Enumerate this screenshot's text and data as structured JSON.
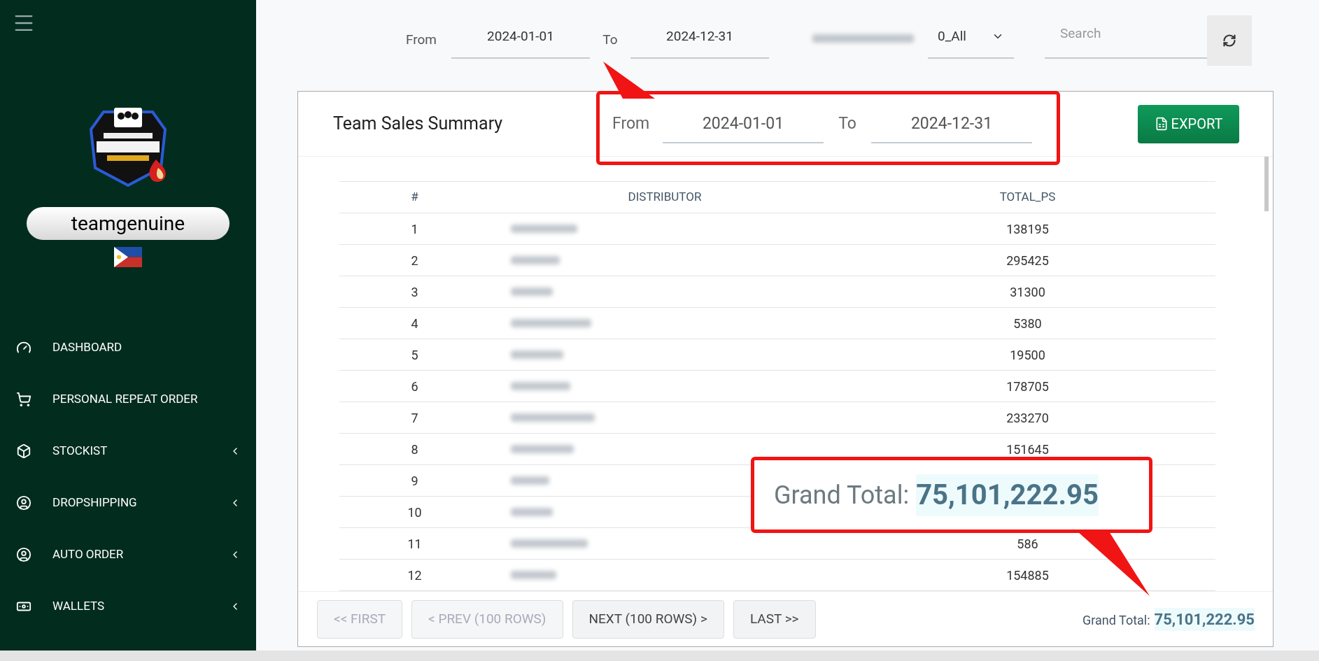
{
  "sidebar": {
    "username": "teamgenuine",
    "menu": [
      {
        "label": "DASHBOARD",
        "has_submenu": false
      },
      {
        "label": "PERSONAL REPEAT ORDER",
        "has_submenu": false
      },
      {
        "label": "STOCKIST",
        "has_submenu": true
      },
      {
        "label": "DROPSHIPPING",
        "has_submenu": true
      },
      {
        "label": "AUTO ORDER",
        "has_submenu": true
      },
      {
        "label": "WALLETS",
        "has_submenu": true
      }
    ]
  },
  "filter_bar": {
    "from_label": "From",
    "from_value": "2024-01-01",
    "to_label": "To",
    "to_value": "2024-12-31",
    "downline_value": "0_All",
    "search_placeholder": "Search"
  },
  "report": {
    "title": "Team Sales Summary",
    "from_label": "From",
    "from_value": "2024-01-01",
    "to_label": "To",
    "to_value": "2024-12-31",
    "export_label": "EXPORT",
    "columns": [
      "#",
      "DISTRIBUTOR",
      "TOTAL_PS"
    ],
    "rows": [
      {
        "index": "1",
        "total": "138195"
      },
      {
        "index": "2",
        "total": "295425"
      },
      {
        "index": "3",
        "total": "31300"
      },
      {
        "index": "4",
        "total": "5380"
      },
      {
        "index": "5",
        "total": "19500"
      },
      {
        "index": "6",
        "total": "178705"
      },
      {
        "index": "7",
        "total": "233270"
      },
      {
        "index": "8",
        "total": "151645"
      },
      {
        "index": "9"
      },
      {
        "index": "10"
      },
      {
        "index": "11",
        "total": "586"
      },
      {
        "index": "12",
        "total": "154885"
      }
    ],
    "pagination": [
      {
        "label": "<< FIRST",
        "disabled": true
      },
      {
        "label": "< PREV (100 ROWS)",
        "disabled": true
      },
      {
        "label": "NEXT (100 ROWS) >",
        "disabled": false
      },
      {
        "label": "LAST >>",
        "disabled": false
      }
    ],
    "grand_total_label": "Grand Total:",
    "grand_total_value": "75,101,222.95"
  },
  "callout": {
    "label": "Grand Total:",
    "value": "75,101,222.95"
  }
}
